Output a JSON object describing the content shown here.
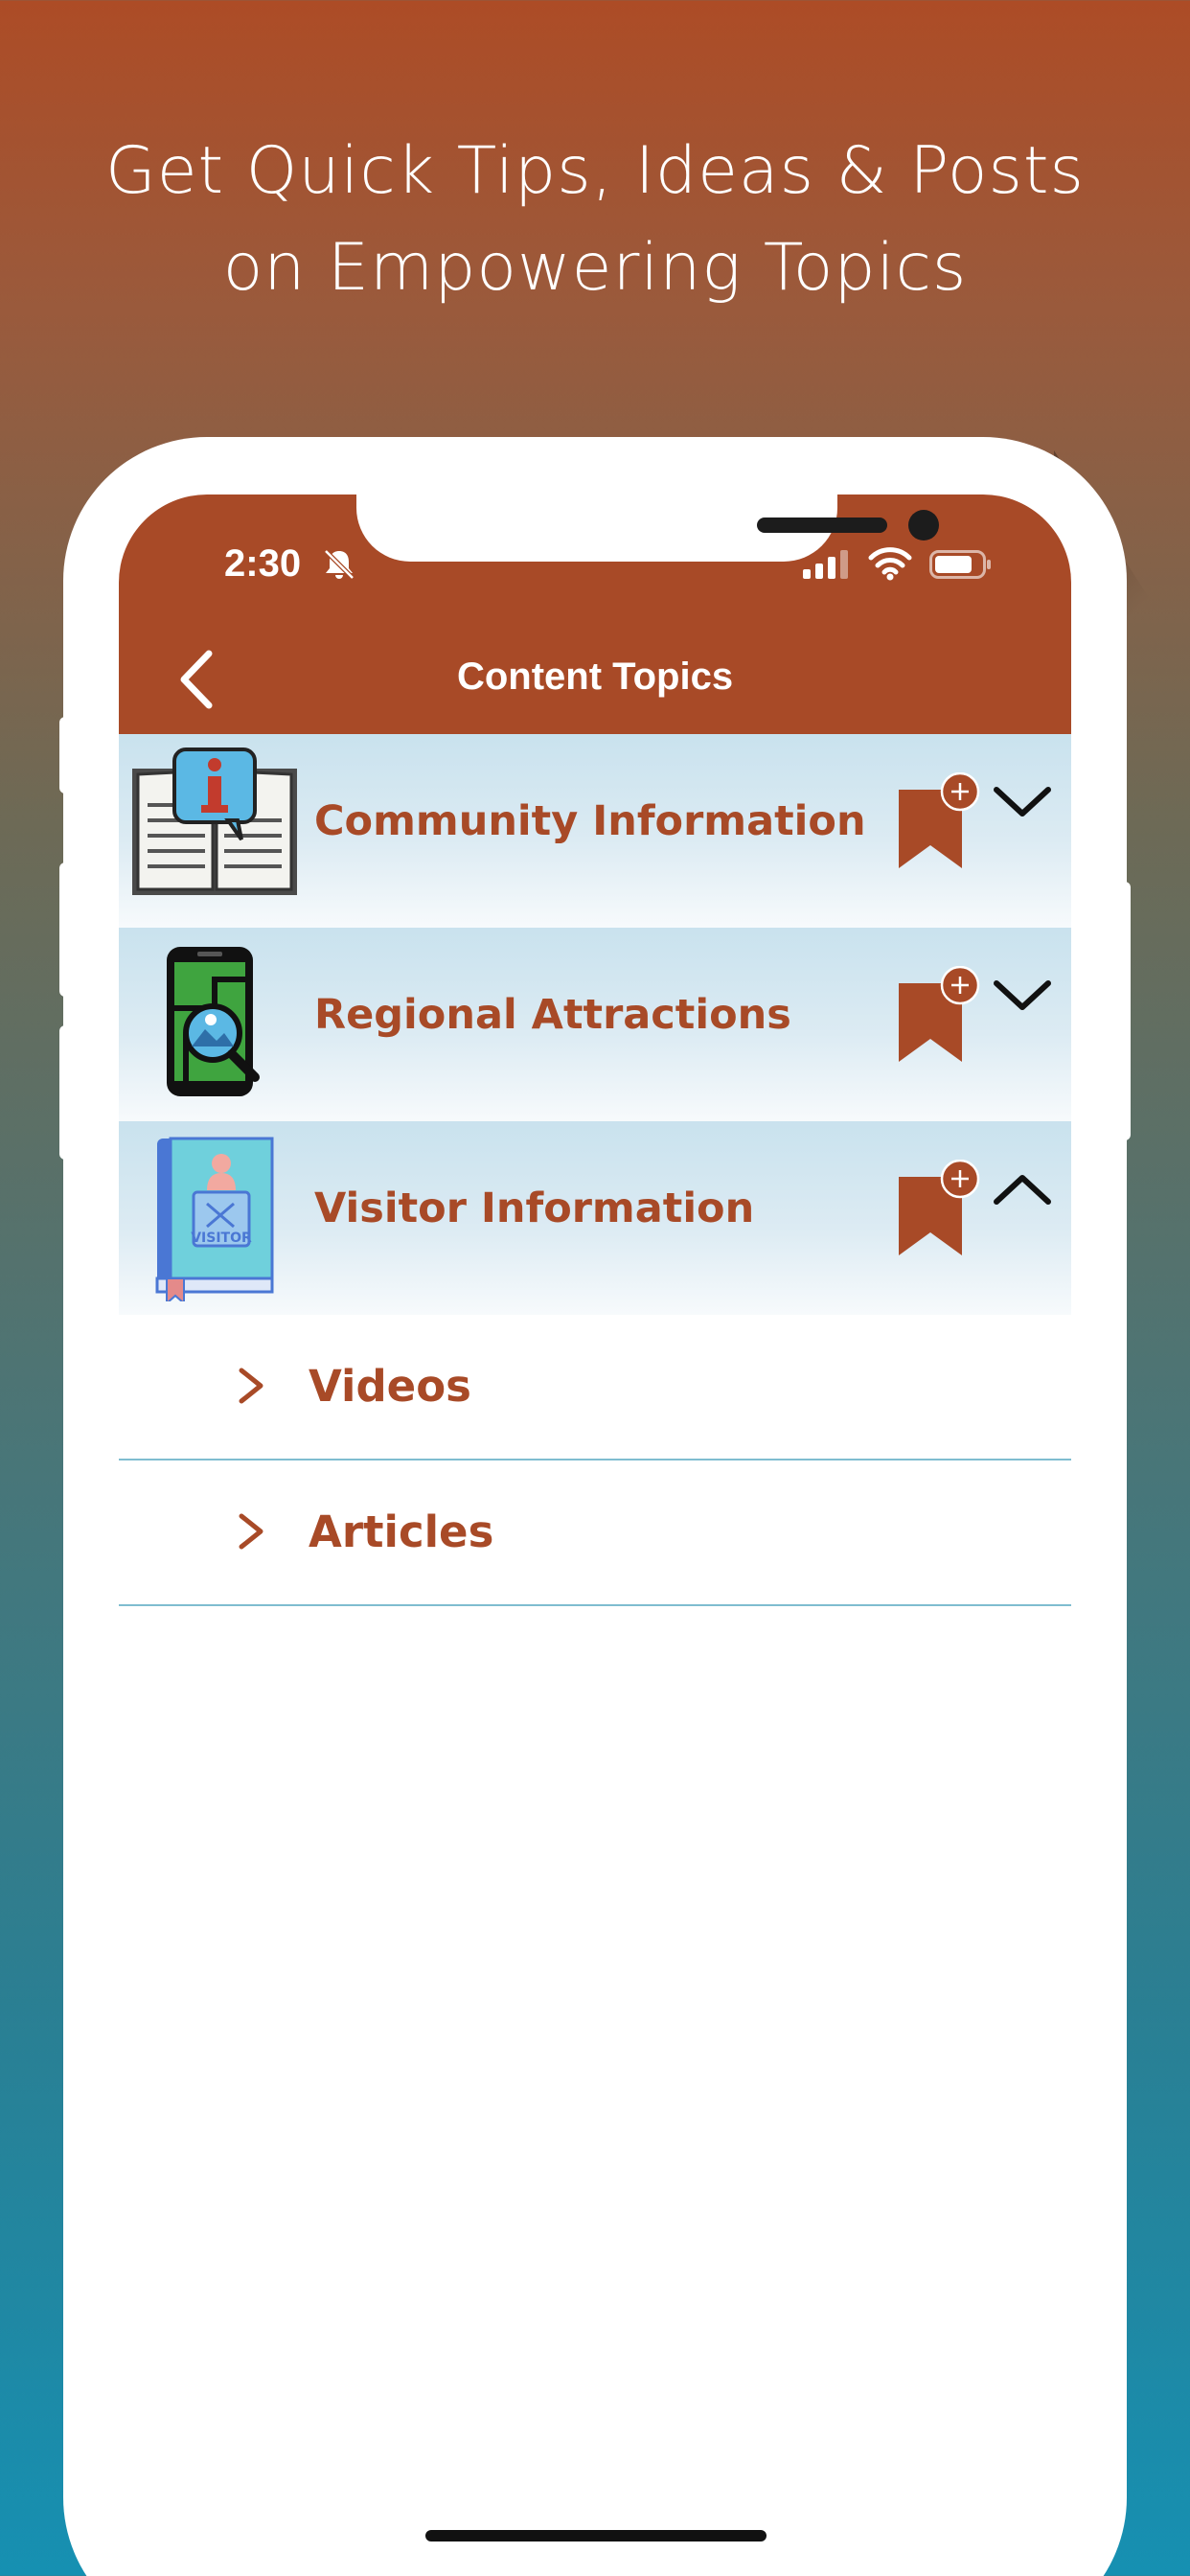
{
  "promo": {
    "title_line1": "Get Quick Tips, Ideas & Posts",
    "title_line2": "on Empowering Topics"
  },
  "status_bar": {
    "time": "2:30",
    "icons": [
      "bell-slash-icon",
      "signal-icon",
      "wifi-icon",
      "battery-icon"
    ]
  },
  "nav": {
    "title": "Content Topics",
    "back_icon": "chevron-left-icon"
  },
  "topics": [
    {
      "label": "Community Information",
      "icon": "open-book-info-icon",
      "expanded": false
    },
    {
      "label": "Regional Attractions",
      "icon": "phone-map-search-icon",
      "expanded": false
    },
    {
      "label": "Visitor Information",
      "icon": "visitor-guide-book-icon",
      "expanded": true
    }
  ],
  "subitems": [
    {
      "label": "Videos"
    },
    {
      "label": "Articles"
    }
  ],
  "colors": {
    "brand": "#a84a27",
    "row_bg": "#c9e2ee",
    "divider": "#7fbdd0"
  }
}
